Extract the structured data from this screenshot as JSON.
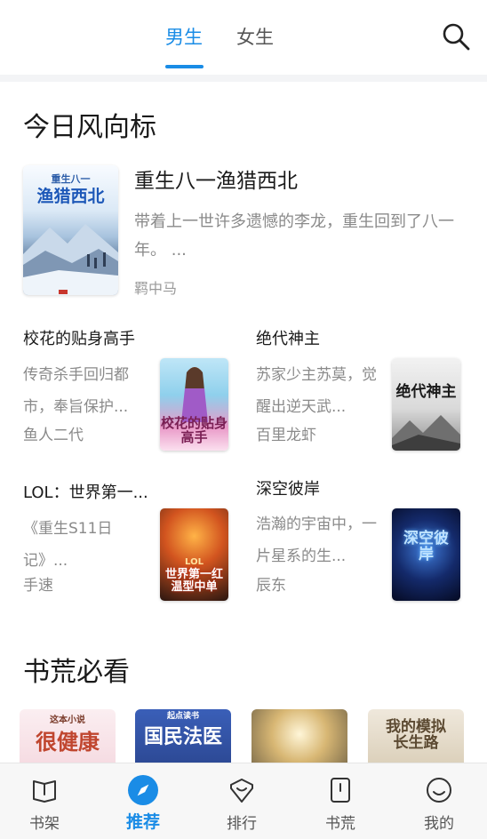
{
  "header": {
    "tabs": [
      {
        "label": "男生",
        "active": true
      },
      {
        "label": "女生",
        "active": false
      }
    ],
    "search_icon": "search-icon",
    "accent": "#1a8ce6"
  },
  "section_today": {
    "title": "今日风向标",
    "featured": {
      "title": "重生八一渔猎西北",
      "desc": "带着上一世许多遗憾的李龙，重生回到了八一年。 ...",
      "author": "羁中马",
      "cover_top": "重生八一",
      "cover_main": "渔猎西北"
    },
    "books": [
      {
        "title": "校花的贴身高手",
        "desc": "传奇杀手回归都市，奉旨保护...",
        "author": "鱼人二代",
        "cover_text": "校花的贴身高手"
      },
      {
        "title": "绝代神主",
        "desc": "苏家少主苏莫，觉醒出逆天武...",
        "author": "百里龙虾",
        "cover_text": "绝代神主"
      },
      {
        "title": "LOL：世界第一...",
        "desc": "《重生S11日记》...",
        "author": "手速",
        "cover_text": "世界第一红温型中单",
        "cover_badge": "LOL"
      },
      {
        "title": "深空彼岸",
        "desc": "浩瀚的宇宙中，一片星系的生...",
        "author": "辰东",
        "cover_text": "深空彼岸"
      }
    ]
  },
  "section_must": {
    "title": "书荒必看",
    "covers": [
      {
        "text": "很健康",
        "badge": "这本小说"
      },
      {
        "text": "国民法医",
        "badge": "起点读书"
      },
      {
        "text": ""
      },
      {
        "text": "我的模拟长生路"
      }
    ]
  },
  "bottom_nav": [
    {
      "label": "书架",
      "icon": "bookshelf-icon",
      "active": false
    },
    {
      "label": "推荐",
      "icon": "compass-icon",
      "active": true
    },
    {
      "label": "排行",
      "icon": "ranking-icon",
      "active": false
    },
    {
      "label": "书荒",
      "icon": "book-icon",
      "active": false
    },
    {
      "label": "我的",
      "icon": "profile-icon",
      "active": false
    }
  ]
}
